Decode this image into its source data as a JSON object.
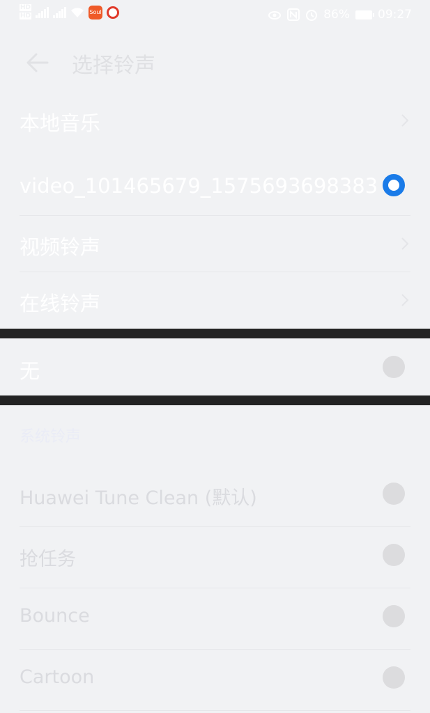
{
  "status_bar": {
    "sim_labels": [
      "HD",
      "HD"
    ],
    "network_labels": [
      "5G",
      "4G"
    ],
    "app_icon_label": "Soul",
    "battery": "86%",
    "time": "09:27"
  },
  "header": {
    "title": "选择铃声"
  },
  "top_items": [
    {
      "label": "本地音乐"
    },
    {
      "label": "video_101465679_1575693698383",
      "selected": true
    },
    {
      "label": "视频铃声"
    },
    {
      "label": "在线铃声"
    }
  ],
  "none_option": {
    "label": "无",
    "selected": false
  },
  "system_section": {
    "title": "系统铃声",
    "items": [
      {
        "label": "Huawei Tune Clean (默认)"
      },
      {
        "label": "抢任务"
      },
      {
        "label": "Bounce"
      },
      {
        "label": "Cartoon"
      }
    ]
  },
  "colors": {
    "accent": "#1a7be8",
    "background": "#f1f2f4",
    "divider_bar": "#232323"
  }
}
